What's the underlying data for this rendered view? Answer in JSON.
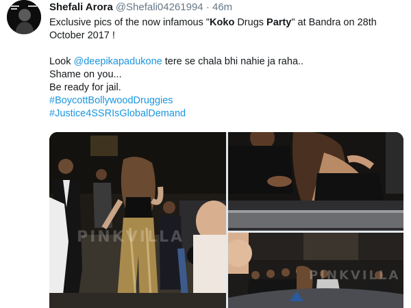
{
  "tweet": {
    "author_name": "Shefali Arora",
    "author_handle": "@Shefali04261994",
    "separator": "·",
    "time": "46m",
    "line1_pre": "Exclusive pics of the now infamous \"",
    "line1_bold1": "Koko",
    "line1_mid1": " Drugs ",
    "line1_bold2": "Party",
    "line1_post": "\" at Bandra on 28th October 2017 !",
    "line2_pre": "Look ",
    "mention": "@deepikapadukone",
    "line2_post": " tere se chala bhi nahie ja raha..",
    "line3": "Shame on you...",
    "line4": "Be ready for jail.",
    "hashtag1": "#BoycottBollywoodDruggies",
    "hashtag2": "#Justice4SSRIsGlobalDemand"
  },
  "media": {
    "photos": [
      "party-photo-main",
      "party-photo-top-right",
      "party-photo-bottom-right"
    ],
    "watermark_main": "PINKVILLA",
    "watermark_br": "PINKVILLA"
  },
  "colors": {
    "link": "#1b95e0",
    "secondary_text": "#657786",
    "primary_text": "#14171a"
  }
}
